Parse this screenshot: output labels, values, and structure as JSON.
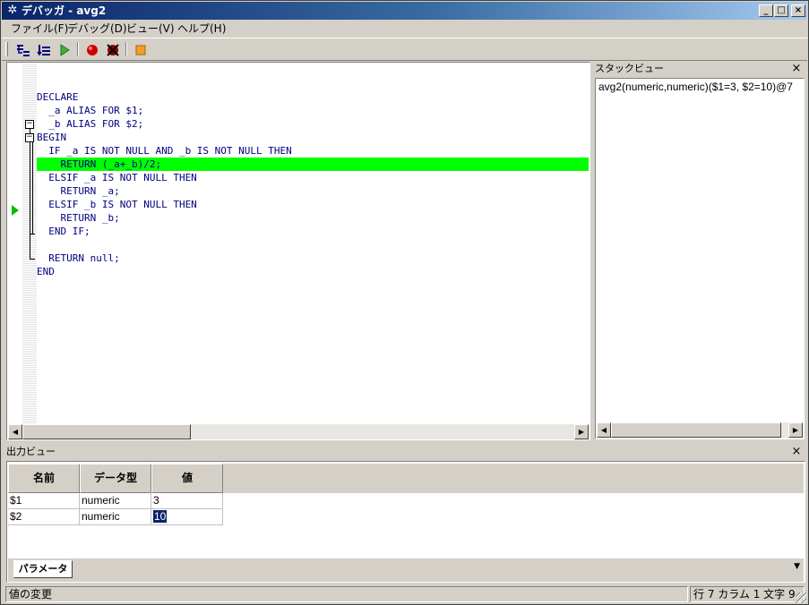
{
  "window": {
    "title": "デバッガ - avg2"
  },
  "menu": [
    "ファイル(F)",
    "デバッグ(D)",
    "ビュー(V)",
    "ヘルプ(H)"
  ],
  "editor": {
    "lines": [
      "",
      "DECLARE",
      "  _a ALIAS FOR $1;",
      "  _b ALIAS FOR $2;",
      "BEGIN",
      "  IF _a IS NOT NULL AND _b IS NOT NULL THEN",
      "    RETURN (_a+_b)/2;",
      "  ELSIF _a IS NOT NULL THEN",
      "    RETURN _a;",
      "  ELSIF _b IS NOT NULL THEN",
      "    RETURN _b;",
      "  END IF;",
      "",
      "  RETURN null;",
      "END"
    ],
    "current_line_index": 6
  },
  "stack": {
    "title": "スタックビュー",
    "items": [
      "avg2(numeric,numeric)($1=3, $2=10)@7"
    ]
  },
  "output": {
    "title": "出力ビュー",
    "columns": [
      "名前",
      "データ型",
      "値"
    ],
    "rows": [
      {
        "name": "$1",
        "type": "numeric",
        "value": "3"
      },
      {
        "name": "$2",
        "type": "numeric",
        "value": "10"
      }
    ],
    "tab": "パラメータ"
  },
  "status": {
    "message": "値の変更",
    "position": "行 7 カラム 1  文字 9"
  }
}
